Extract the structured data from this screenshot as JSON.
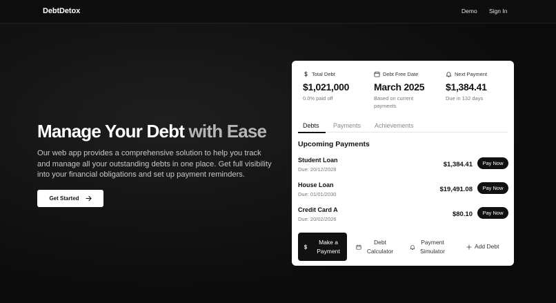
{
  "nav": {
    "brand": "DebtDetox",
    "demo": "Demo",
    "signin": "Sign In"
  },
  "hero": {
    "title_main": "Manage Your Debt ",
    "title_accent": "with Ease",
    "description": "Our web app provides a comprehensive solution to help you track and manage all your outstanding debts in one place. Get full visibility into your financial obligations and set up payment reminders.",
    "cta": "Get Started"
  },
  "stats": [
    {
      "icon": "dollar-icon",
      "label": "Total Debt",
      "value": "$1,021,000",
      "sub": "0.0% paid off"
    },
    {
      "icon": "calendar-icon",
      "label": "Debt Free Date",
      "value": "March 2025",
      "sub": "Based on current payments"
    },
    {
      "icon": "bell-icon",
      "label": "Next Payment",
      "value": "$1,384.41",
      "sub": "Due in 132 days"
    }
  ],
  "tabs": [
    "Debts",
    "Payments",
    "Achievements"
  ],
  "upcoming": {
    "title": "Upcoming Payments",
    "pay_label": "Pay Now",
    "items": [
      {
        "name": "Student Loan",
        "due": "Due: 20/12/2028",
        "amount": "$1,384.41"
      },
      {
        "name": "House Loan",
        "due": "Due: 01/01/2030",
        "amount": "$19,491.08"
      },
      {
        "name": "Credit Card A",
        "due": "Due: 20/02/2026",
        "amount": "$80.10"
      }
    ]
  },
  "actions": {
    "make_payment": "Make a Payment",
    "debt_calculator": "Debt Calculator",
    "payment_simulator": "Payment Simulator",
    "add_debt": "Add Debt"
  }
}
